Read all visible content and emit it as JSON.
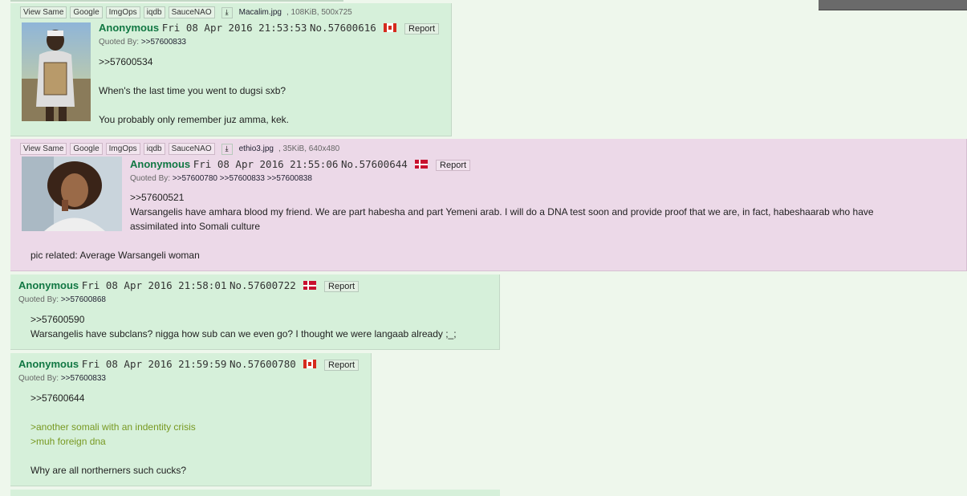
{
  "posts": [
    {
      "toolbar": [
        "View Same",
        "Google",
        "ImgOps",
        "iqdb",
        "SauceNAO"
      ],
      "file_name": "Macalim.jpg",
      "file_info": ", 108KiB, 500x725",
      "name": "Anonymous",
      "datetime": "Fri 08 Apr 2016 21:53:53",
      "post_no": "No.57600616",
      "flag": "canada-flag-icon",
      "report": "Report",
      "quoted_by_label": "Quoted By:",
      "quoted_by": ">>57600833",
      "lines": [
        ">>57600534",
        "When's the last time you went to dugsi sxb?",
        "You probably only remember juz amma, kek."
      ]
    },
    {
      "toolbar": [
        "View Same",
        "Google",
        "ImgOps",
        "iqdb",
        "SauceNAO"
      ],
      "file_name": "ethio3.jpg",
      "file_info": ", 35KiB, 640x480",
      "name": "Anonymous",
      "datetime": "Fri 08 Apr 2016 21:55:06",
      "post_no": "No.57600644",
      "flag": "denmark-flag-icon",
      "report": "Report",
      "quoted_by_label": "Quoted By:",
      "quoted_by": ">>57600780 >>57600833 >>57600838",
      "lines": [
        ">>57600521",
        "Warsangelis have amhara blood my friend. We are part habesha and part Yemeni arab. I will do a DNA test soon and provide proof that we are, in fact, habeshaarab who have",
        "assimilated into Somali culture",
        "pic related: Average Warsangeli woman"
      ]
    },
    {
      "name": "Anonymous",
      "datetime": "Fri 08 Apr 2016 21:58:01",
      "post_no": "No.57600722",
      "flag": "denmark-flag-icon",
      "report": "Report",
      "quoted_by_label": "Quoted By:",
      "quoted_by": ">>57600868",
      "lines": [
        ">>57600590",
        "Warsangelis have subclans? nigga how sub can we even go? I thought we were langaab already ;_;"
      ]
    },
    {
      "name": "Anonymous",
      "datetime": "Fri 08 Apr 2016 21:59:59",
      "post_no": "No.57600780",
      "flag": "canada-flag-icon",
      "report": "Report",
      "quoted_by_label": "Quoted By:",
      "quoted_by": ">>57600833",
      "lines": [
        ">>57600644",
        ">another somali with an indentity crisis",
        ">muh foreign dna",
        "Why are all northerners such cucks?"
      ]
    }
  ],
  "download_icon": "download-icon",
  "colors": {
    "name": "#117743",
    "greentext": "#789922",
    "post_bg": "#d6f0da",
    "highlight_bg": "#ecd9e8",
    "page_bg": "#eef7ec"
  }
}
